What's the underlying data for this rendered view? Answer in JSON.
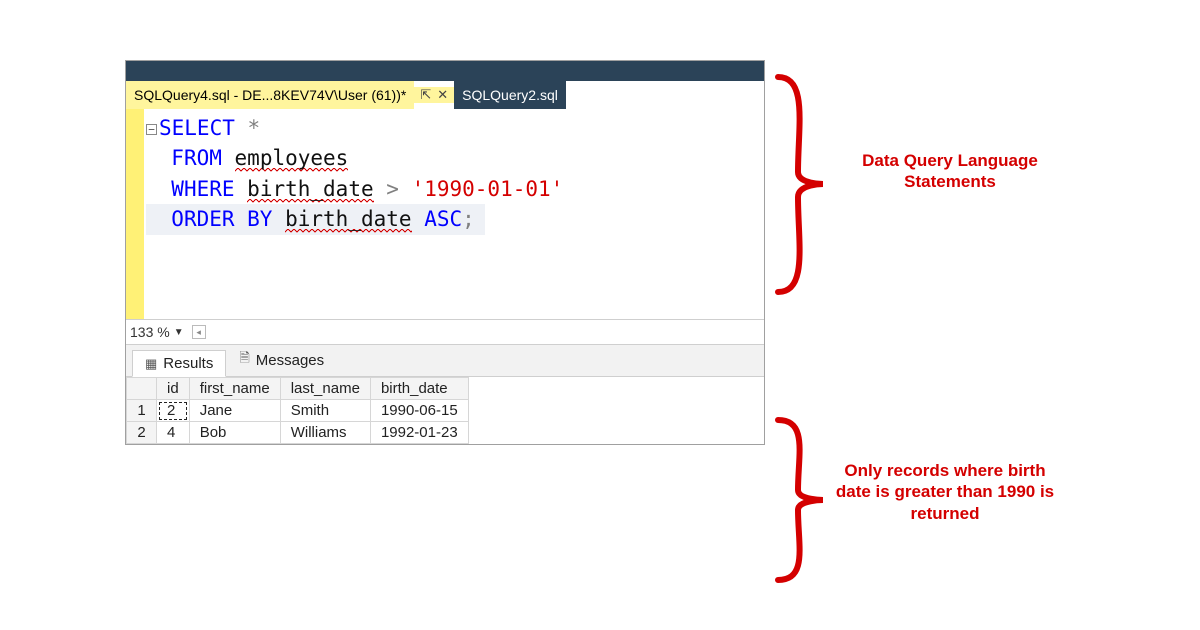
{
  "tabs": {
    "active": "SQLQuery4.sql - DE...8KEV74V\\User (61))*",
    "inactive": "SQLQuery2.sql",
    "pin": "⇱",
    "close": "✕"
  },
  "code": {
    "l1_kw": "SELECT",
    "l1_rest": " *",
    "l2_kw": "FROM",
    "l2_ident": "employees",
    "l3_kw": "WHERE",
    "l3_ident": "birth_date",
    "l3_op": ">",
    "l3_str": "'1990-01-01'",
    "l4_kw": "ORDER BY",
    "l4_ident": "birth_date",
    "l4_kw2": "ASC",
    "l4_semi": ";"
  },
  "zoom": {
    "value": "133 %"
  },
  "result_tabs": {
    "results": "Results",
    "messages": "Messages"
  },
  "grid": {
    "headers": [
      "",
      "id",
      "first_name",
      "last_name",
      "birth_date"
    ],
    "rows": [
      {
        "n": "1",
        "id": "2",
        "first_name": "Jane",
        "last_name": "Smith",
        "birth_date": "1990-06-15"
      },
      {
        "n": "2",
        "id": "4",
        "first_name": "Bob",
        "last_name": "Williams",
        "birth_date": "1992-01-23"
      }
    ]
  },
  "annot": {
    "top": "Data Query Language Statements",
    "bottom": "Only records where birth date is greater than 1990 is returned"
  }
}
